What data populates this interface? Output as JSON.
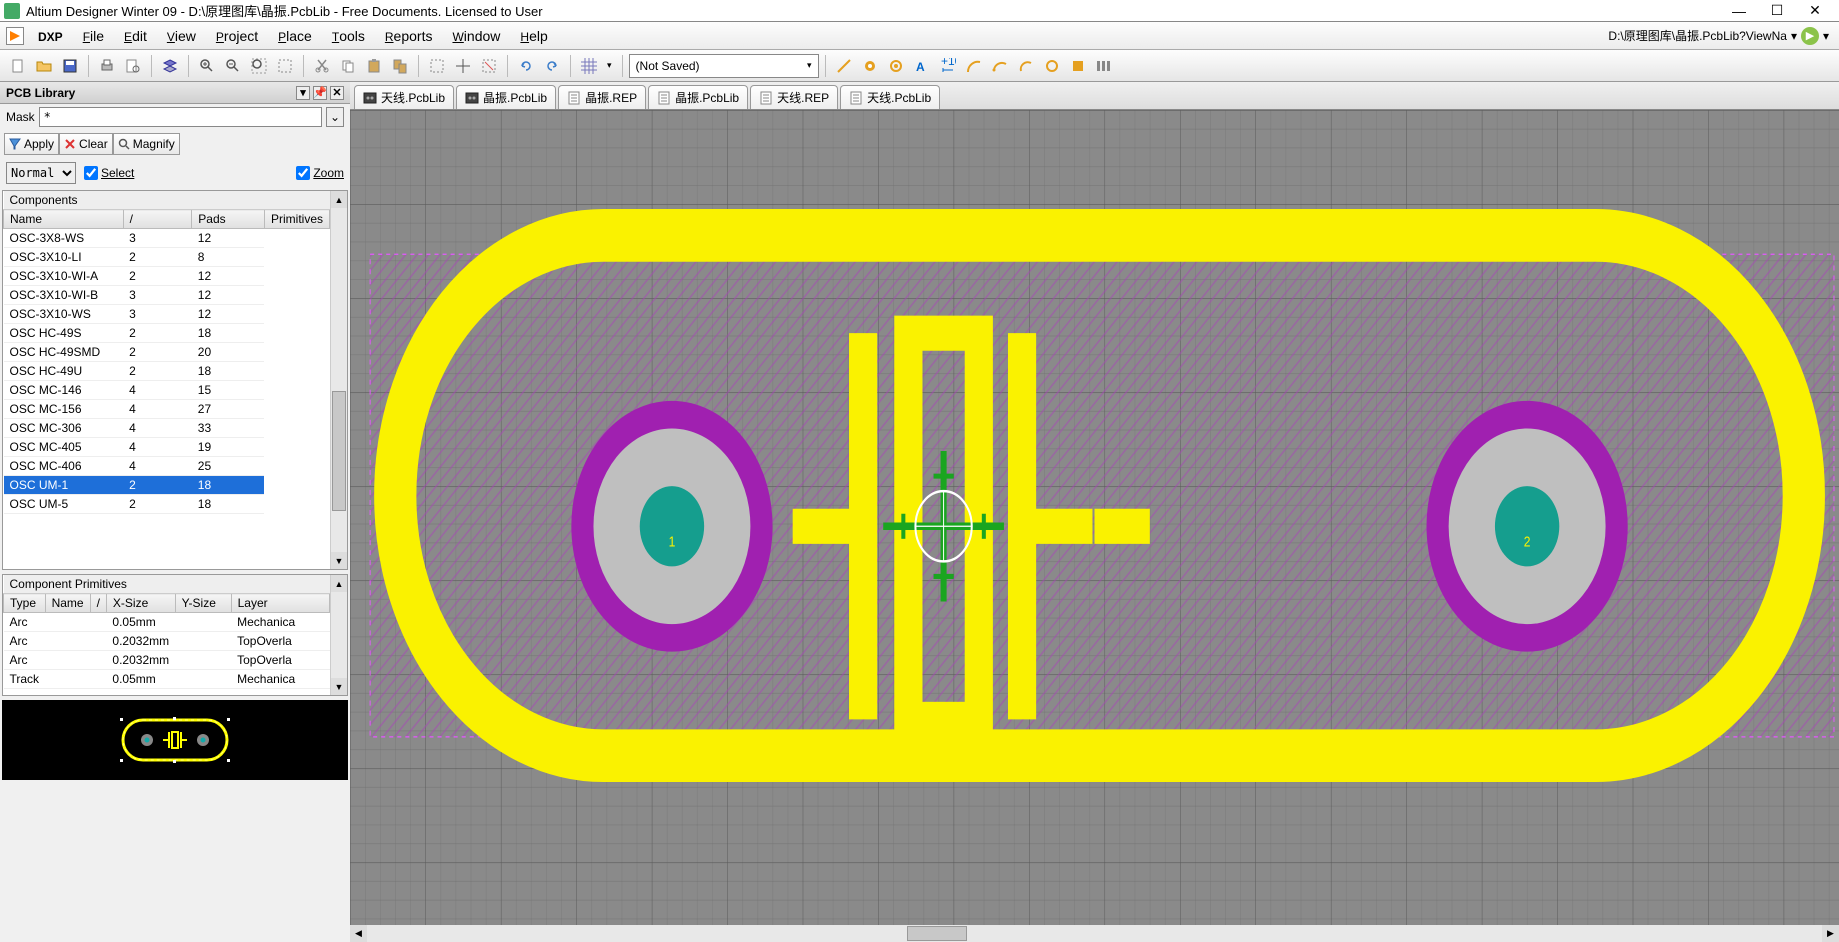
{
  "title": "Altium Designer Winter 09 - D:\\原理图库\\晶振.PcbLib - Free Documents. Licensed to User",
  "menu": [
    "DXP",
    "File",
    "Edit",
    "View",
    "Project",
    "Place",
    "Tools",
    "Reports",
    "Window",
    "Help"
  ],
  "filepath_right": "D:\\原理图库\\晶振.PcbLib?ViewNa",
  "toolbar_combo": "(Not Saved)",
  "panel_title": "PCB Library",
  "mask_label": "Mask",
  "mask_value": "*",
  "actions": {
    "apply": "Apply",
    "clear": "Clear",
    "magnify": "Magnify"
  },
  "normal_combo": "Normal",
  "select_cb": "Select",
  "zoom_cb": "Zoom",
  "components_header": "Components",
  "components_cols": [
    "Name",
    "/",
    "Pads",
    "Primitives"
  ],
  "components_rows": [
    {
      "name": "OSC-3X8-WS",
      "pads": "3",
      "prim": "12"
    },
    {
      "name": "OSC-3X10-LI",
      "pads": "2",
      "prim": "8"
    },
    {
      "name": "OSC-3X10-WI-A",
      "pads": "2",
      "prim": "12"
    },
    {
      "name": "OSC-3X10-WI-B",
      "pads": "3",
      "prim": "12"
    },
    {
      "name": "OSC-3X10-WS",
      "pads": "3",
      "prim": "12"
    },
    {
      "name": "OSC HC-49S",
      "pads": "2",
      "prim": "18"
    },
    {
      "name": "OSC HC-49SMD",
      "pads": "2",
      "prim": "20"
    },
    {
      "name": "OSC HC-49U",
      "pads": "2",
      "prim": "18"
    },
    {
      "name": "OSC MC-146",
      "pads": "4",
      "prim": "15"
    },
    {
      "name": "OSC MC-156",
      "pads": "4",
      "prim": "27"
    },
    {
      "name": "OSC MC-306",
      "pads": "4",
      "prim": "33"
    },
    {
      "name": "OSC MC-405",
      "pads": "4",
      "prim": "19"
    },
    {
      "name": "OSC MC-406",
      "pads": "4",
      "prim": "25"
    },
    {
      "name": "OSC UM-1",
      "pads": "2",
      "prim": "18",
      "selected": true
    },
    {
      "name": "OSC UM-5",
      "pads": "2",
      "prim": "18"
    }
  ],
  "primitives_header": "Component Primitives",
  "primitives_cols": [
    "Type",
    "Name",
    "/",
    "X-Size",
    "Y-Size",
    "Layer"
  ],
  "primitives_rows": [
    {
      "type": "Arc",
      "name": "",
      "xsize": "0.05mm",
      "ysize": "",
      "layer": "Mechanica"
    },
    {
      "type": "Arc",
      "name": "",
      "xsize": "0.2032mm",
      "ysize": "",
      "layer": "TopOverla"
    },
    {
      "type": "Arc",
      "name": "",
      "xsize": "0.2032mm",
      "ysize": "",
      "layer": "TopOverla"
    },
    {
      "type": "Track",
      "name": "",
      "xsize": "0.05mm",
      "ysize": "",
      "layer": "Mechanica"
    }
  ],
  "doc_tabs": [
    {
      "label": "天线.PcbLib",
      "icon": "pcb"
    },
    {
      "label": "晶振.PcbLib",
      "icon": "pcb"
    },
    {
      "label": "晶振.REP",
      "icon": "rep"
    },
    {
      "label": "晶振.PcbLib",
      "icon": "rep"
    },
    {
      "label": "天线.REP",
      "icon": "rep"
    },
    {
      "label": "天线.PcbLib",
      "icon": "rep"
    }
  ],
  "pad1": "1",
  "pad2": "2"
}
